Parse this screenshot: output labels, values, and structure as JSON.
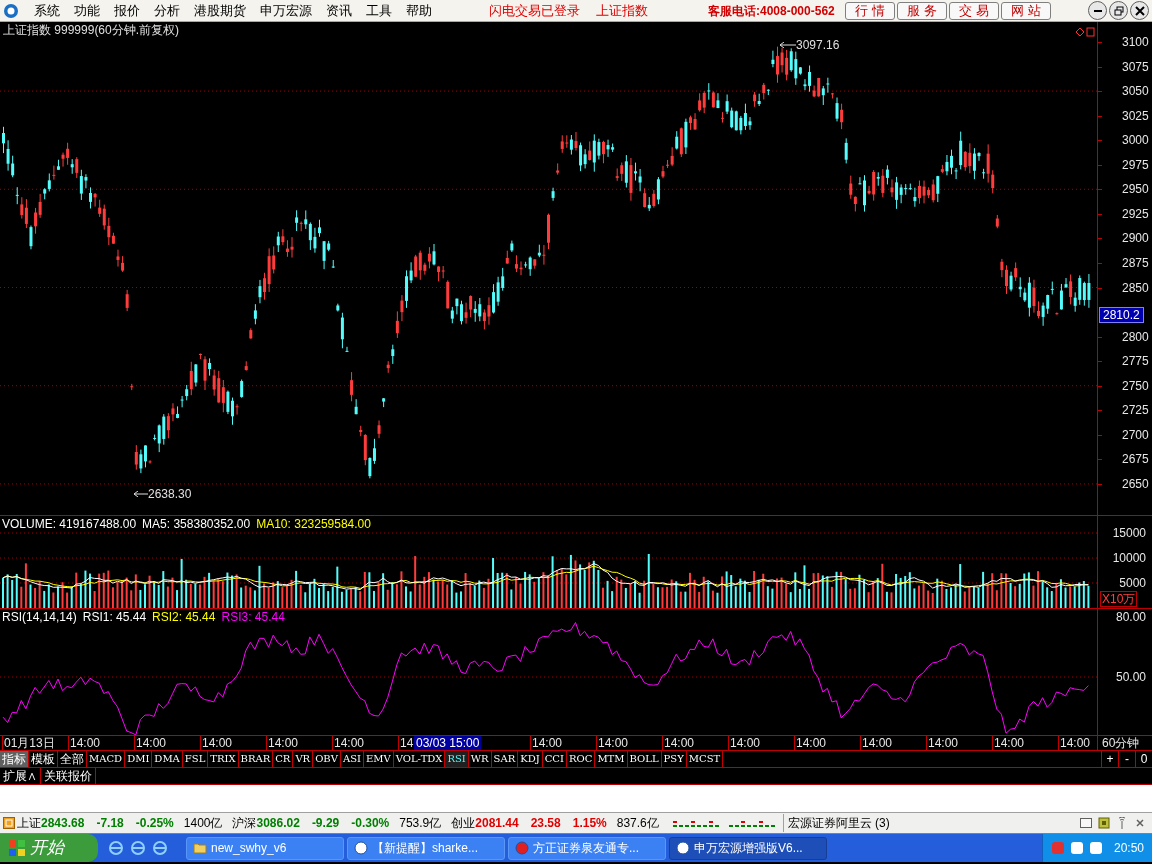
{
  "menu": {
    "items": [
      "系统",
      "功能",
      "报价",
      "分析",
      "港股期货",
      "申万宏源",
      "资讯",
      "工具",
      "帮助"
    ],
    "notices": [
      "闪电交易已登录",
      "上证指数"
    ],
    "hotline": "客服电话:4008-000-562",
    "buttons": [
      "行 情",
      "服 务",
      "交 易",
      "网 站"
    ]
  },
  "chart": {
    "title": "上证指数 999999(60分钟.前复权)",
    "high_label": "3097.16",
    "low_label": "2638.30",
    "price_axis": [
      "3100",
      "3075",
      "3050",
      "3025",
      "3000",
      "2975",
      "2950",
      "2925",
      "2900",
      "2875",
      "2850",
      "2800",
      "2775",
      "2750",
      "2725",
      "2700",
      "2675",
      "2650"
    ],
    "current_price": "2810.2"
  },
  "volume": {
    "legend": [
      {
        "text": "VOLUME: 419167488.00",
        "color": "#ffffff"
      },
      {
        "text": "MA5: 358380352.00",
        "color": "#ffffff"
      },
      {
        "text": "MA10: 323259584.00",
        "color": "#ffff00"
      }
    ],
    "axis": [
      "15000",
      "10000",
      "5000"
    ],
    "unit": "X10万"
  },
  "rsi": {
    "legend": [
      {
        "text": "RSI(14,14,14)",
        "color": "#ffffff"
      },
      {
        "text": "RSI1: 45.44",
        "color": "#ffffff"
      },
      {
        "text": "RSI2: 45.44",
        "color": "#ffff00"
      },
      {
        "text": "RSI3: 45.44",
        "color": "#ff00ff"
      }
    ],
    "axis": [
      "80.00",
      "50.00"
    ]
  },
  "time_axis": {
    "labels": [
      "01月13日",
      "14:00",
      "14:00",
      "14:00",
      "14:00",
      "14:00",
      "14",
      "14:00",
      "14:00",
      "14:00",
      "14:00",
      "14:00",
      "14:00",
      "14:00",
      "14:00",
      "14:00"
    ],
    "cursor_label": "03/03 15:00",
    "period": "60分钟"
  },
  "indicator_tabs": [
    {
      "label": "指标",
      "selected": true
    },
    {
      "label": "模板",
      "selected": false
    },
    {
      "label": "全部",
      "selected": false
    },
    {
      "label": "MACD",
      "selected": false
    },
    {
      "label": "DMI",
      "selected": false
    },
    {
      "label": "DMA",
      "selected": false
    },
    {
      "label": "FSL",
      "selected": false
    },
    {
      "label": "TRIX",
      "selected": false
    },
    {
      "label": "BRAR",
      "selected": false
    },
    {
      "label": "CR",
      "selected": false
    },
    {
      "label": "VR",
      "selected": false
    },
    {
      "label": "OBV",
      "selected": false
    },
    {
      "label": "ASI",
      "selected": false
    },
    {
      "label": "EMV",
      "selected": false
    },
    {
      "label": "VOL-TDX",
      "selected": false
    },
    {
      "label": "RSI",
      "selected": true
    },
    {
      "label": "WR",
      "selected": false
    },
    {
      "label": "SAR",
      "selected": false
    },
    {
      "label": "KDJ",
      "selected": false
    },
    {
      "label": "CCI",
      "selected": false
    },
    {
      "label": "ROC",
      "selected": false
    },
    {
      "label": "MTM",
      "selected": false
    },
    {
      "label": "BOLL",
      "selected": false
    },
    {
      "label": "PSY",
      "selected": false
    },
    {
      "label": "MCST",
      "selected": false
    }
  ],
  "zoom_buttons": [
    "+",
    "-",
    "0"
  ],
  "bottom_tabs": [
    "扩展∧",
    "关联报价"
  ],
  "status_bar": {
    "indices": [
      {
        "name": "上证",
        "value": "2843.68",
        "change": "-7.18",
        "percent": "-0.25%",
        "amount": "1400亿",
        "up": false
      },
      {
        "name": "沪深",
        "value": "3086.02",
        "change": "-9.29",
        "percent": "-0.30%",
        "amount": "753.9亿",
        "up": false
      },
      {
        "name": "创业",
        "value": "2081.44",
        "change": "23.58",
        "percent": "1.15%",
        "amount": "837.6亿",
        "up": true
      }
    ],
    "server": "宏源证券阿里云 (3)"
  },
  "taskbar": {
    "start": "开始",
    "tasks": [
      {
        "label": "new_swhy_v6",
        "selected": false
      },
      {
        "label": "【新提醒】sharke...",
        "selected": false
      },
      {
        "label": "方正证券泉友通专...",
        "selected": false
      },
      {
        "label": "申万宏源增强版V6...",
        "selected": true
      }
    ],
    "clock": "20:50"
  }
}
